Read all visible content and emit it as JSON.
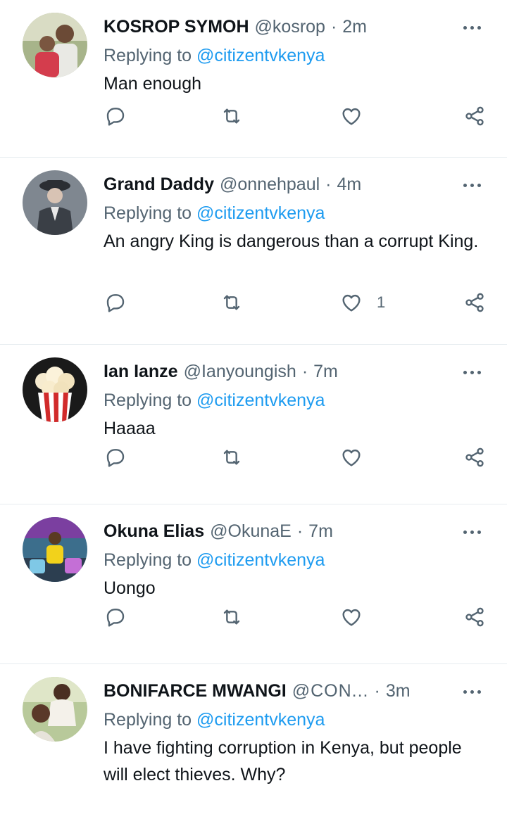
{
  "colors": {
    "text": "#0f1419",
    "muted": "#536471",
    "link": "#1d9bf0",
    "divider": "#e6ecf0"
  },
  "reply_prefix": "Replying to",
  "tweets": [
    {
      "name": "KOSROP SYMOH",
      "handle": "@kosrop",
      "separator": "·",
      "time": "2m",
      "replying_to": "@citizentvkenya",
      "text": "Man enough",
      "likes": ""
    },
    {
      "name": "Grand Daddy",
      "handle": "@onnehpaul",
      "separator": "·",
      "time": "4m",
      "replying_to": "@citizentvkenya",
      "text": "An angry King is dangerous than a corrupt King.",
      "likes": "1"
    },
    {
      "name": "Ian Ianze",
      "handle": "@Ianyoungish",
      "separator": "·",
      "time": "7m",
      "replying_to": "@citizentvkenya",
      "text": "Haaaa",
      "likes": ""
    },
    {
      "name": "Okuna Elias",
      "handle": "@OkunaE",
      "separator": "·",
      "time": "7m",
      "replying_to": "@citizentvkenya",
      "text": "Uongo",
      "likes": ""
    },
    {
      "name": "BONIFARCE MWANGI",
      "handle": "@CON...",
      "separator": "·",
      "time": "3m",
      "replying_to": "@citizentvkenya",
      "text": "I have fighting corruption in Kenya, but people will elect thieves. Why?",
      "likes": ""
    }
  ]
}
